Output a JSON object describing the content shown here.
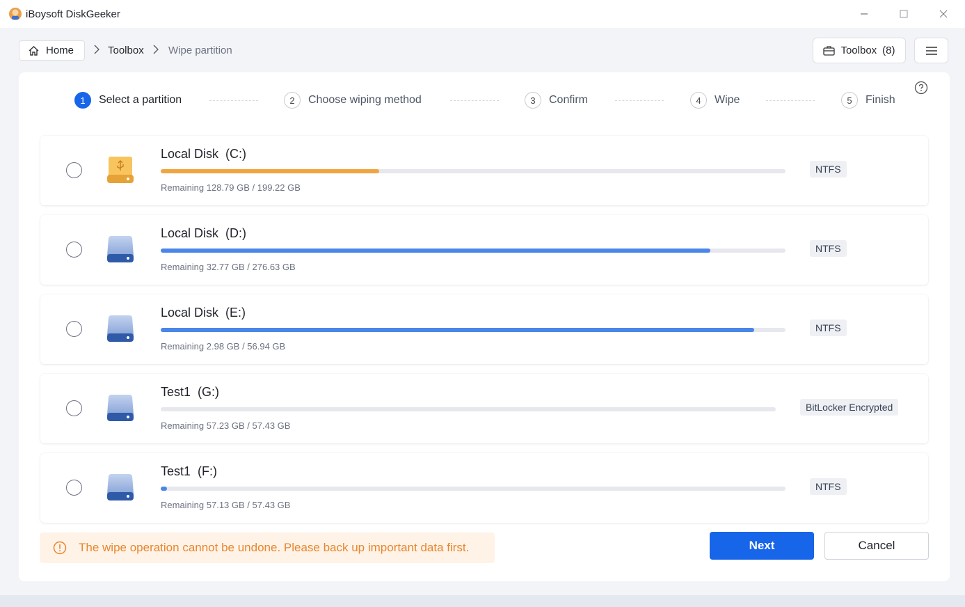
{
  "window": {
    "title": "iBoysoft DiskGeeker"
  },
  "nav": {
    "home_label": "Home",
    "breadcrumb": [
      "Toolbox",
      "Wipe partition"
    ],
    "toolbox_label": "Toolbox",
    "toolbox_count": "(8)"
  },
  "steps": [
    {
      "num": "1",
      "label": "Select a partition",
      "active": true
    },
    {
      "num": "2",
      "label": "Choose wiping method",
      "active": false
    },
    {
      "num": "3",
      "label": "Confirm",
      "active": false
    },
    {
      "num": "4",
      "label": "Wipe",
      "active": false
    },
    {
      "num": "5",
      "label": "Finish",
      "active": false
    }
  ],
  "disks": [
    {
      "name": "Local Disk  (C:)",
      "remaining": "Remaining 128.79 GB / 199.22 GB",
      "used_fraction": 0.35,
      "filesystem": "NTFS",
      "icon": "usb-drive-icon",
      "color": "#f0a640"
    },
    {
      "name": "Local Disk  (D:)",
      "remaining": "Remaining 32.77 GB / 276.63 GB",
      "used_fraction": 0.88,
      "filesystem": "NTFS",
      "icon": "hard-drive-icon",
      "color": "#4a86e8"
    },
    {
      "name": "Local Disk  (E:)",
      "remaining": "Remaining 2.98 GB / 56.94 GB",
      "used_fraction": 0.95,
      "filesystem": "NTFS",
      "icon": "hard-drive-icon",
      "color": "#4a86e8"
    },
    {
      "name": "Test1  (G:)",
      "remaining": "Remaining 57.23 GB / 57.43 GB",
      "used_fraction": 0.0,
      "filesystem": "BitLocker Encrypted",
      "icon": "hard-drive-icon",
      "color": "#4a86e8"
    },
    {
      "name": "Test1  (F:)",
      "remaining": "Remaining 57.13 GB / 57.43 GB",
      "used_fraction": 0.01,
      "filesystem": "NTFS",
      "icon": "hard-drive-icon",
      "color": "#4a86e8"
    }
  ],
  "warning": {
    "text": "The wipe operation cannot be undone. Please back up important data first."
  },
  "buttons": {
    "next": "Next",
    "cancel": "Cancel"
  },
  "colors": {
    "accent": "#1765e8",
    "warning": "#e8862c"
  }
}
